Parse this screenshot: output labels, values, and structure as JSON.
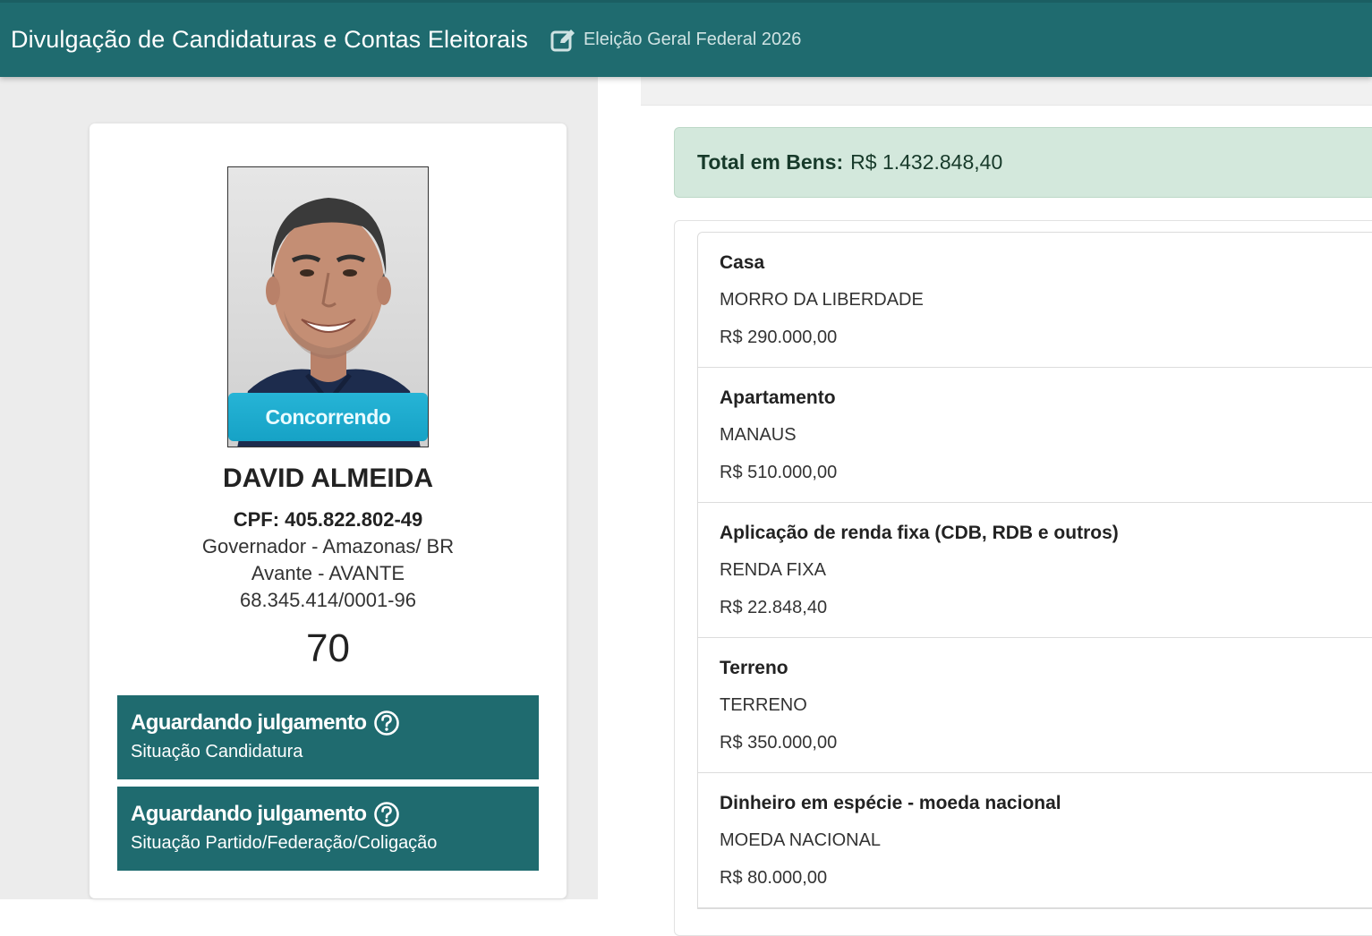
{
  "header": {
    "title": "Divulgação de Candidaturas e Contas Eleitorais",
    "election": "Eleição Geral Federal 2026",
    "edit_icon": "edit-icon"
  },
  "candidate": {
    "status_badge": "Concorrendo",
    "name": "DAVID ALMEIDA",
    "cpf": "CPF: 405.822.802-49",
    "office": "Governador - Amazonas/ BR",
    "party": "Avante - AVANTE",
    "cnpj": "68.345.414/0001-96",
    "number": "70",
    "situations": [
      {
        "title": "Aguardando julgamento",
        "subtitle": "Situação Candidatura",
        "icon": "help-icon"
      },
      {
        "title": "Aguardando julgamento",
        "subtitle": "Situação Partido/Federação/Coligação",
        "icon": "help-icon"
      }
    ]
  },
  "assets": {
    "total_label": "Total em Bens:",
    "total_value": "R$ 1.432.848,40",
    "items": [
      {
        "type": "Casa",
        "description": "MORRO DA LIBERDADE",
        "value": "R$ 290.000,00"
      },
      {
        "type": "Apartamento",
        "description": "MANAUS",
        "value": "R$ 510.000,00"
      },
      {
        "type": "Aplicação de renda fixa (CDB, RDB e outros)",
        "description": "RENDA FIXA",
        "value": "R$ 22.848,40"
      },
      {
        "type": "Terreno",
        "description": "TERRENO",
        "value": "R$ 350.000,00"
      },
      {
        "type": "Dinheiro em espécie - moeda nacional",
        "description": "MOEDA NACIONAL",
        "value": "R$ 80.000,00"
      }
    ]
  },
  "colors": {
    "header_bg": "#1f6b6f",
    "status_box_bg": "#1f6b6f",
    "badge_bg": "#16a2c6",
    "total_bg": "#d3e8dc"
  }
}
